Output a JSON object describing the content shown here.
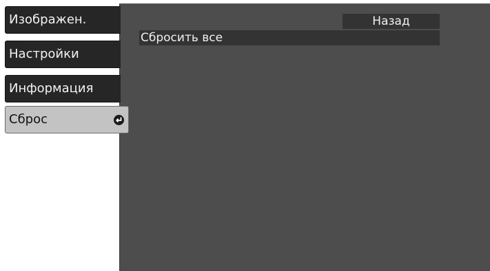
{
  "sidebar": {
    "items": [
      {
        "label": "Изображен."
      },
      {
        "label": "Настройки"
      },
      {
        "label": "Информация"
      },
      {
        "label": "Сброс",
        "active": true
      }
    ]
  },
  "main": {
    "back_label": "Назад",
    "rows": [
      {
        "label": "Сбросить все"
      }
    ]
  },
  "colors": {
    "panel": "#4d4d4d",
    "sidebar_item": "#262626",
    "sidebar_active": "#c3c3c3",
    "row_highlight": "#333333"
  },
  "icons": {
    "active_item": "enter-icon"
  }
}
